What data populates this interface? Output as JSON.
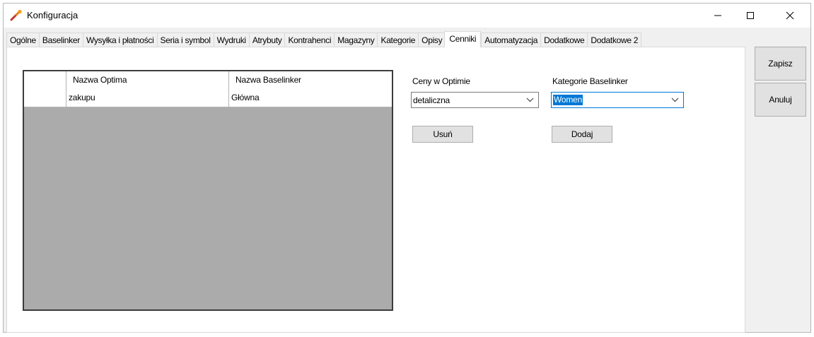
{
  "window": {
    "title": "Konfiguracja"
  },
  "tabs": [
    {
      "label": "Ogólne"
    },
    {
      "label": "Baselinker"
    },
    {
      "label": "Wysyłka i płatności"
    },
    {
      "label": "Seria i symbol"
    },
    {
      "label": "Wydruki"
    },
    {
      "label": "Atrybuty"
    },
    {
      "label": "Kontrahenci"
    },
    {
      "label": "Magazyny"
    },
    {
      "label": "Kategorie"
    },
    {
      "label": "Opisy"
    },
    {
      "label": "Cenniki",
      "active": true
    },
    {
      "label": "Automatyzacja"
    },
    {
      "label": "Dodatkowe"
    },
    {
      "label": "Dodatkowe 2"
    }
  ],
  "grid": {
    "columns": [
      "",
      "Nazwa Optima",
      "Nazwa Baselinker"
    ],
    "rows": [
      [
        "",
        "zakupu",
        "Główna"
      ]
    ]
  },
  "prices": {
    "label": "Ceny w Optimie",
    "selected": "detaliczna"
  },
  "categories": {
    "label": "Kategorie Baselinker",
    "selected": "Women"
  },
  "buttons": {
    "remove": "Usuń",
    "add": "Dodaj",
    "save": "Zapisz",
    "cancel": "Anuluj"
  },
  "colors": {
    "accent": "#0078d7",
    "grid_background": "#ababab"
  }
}
